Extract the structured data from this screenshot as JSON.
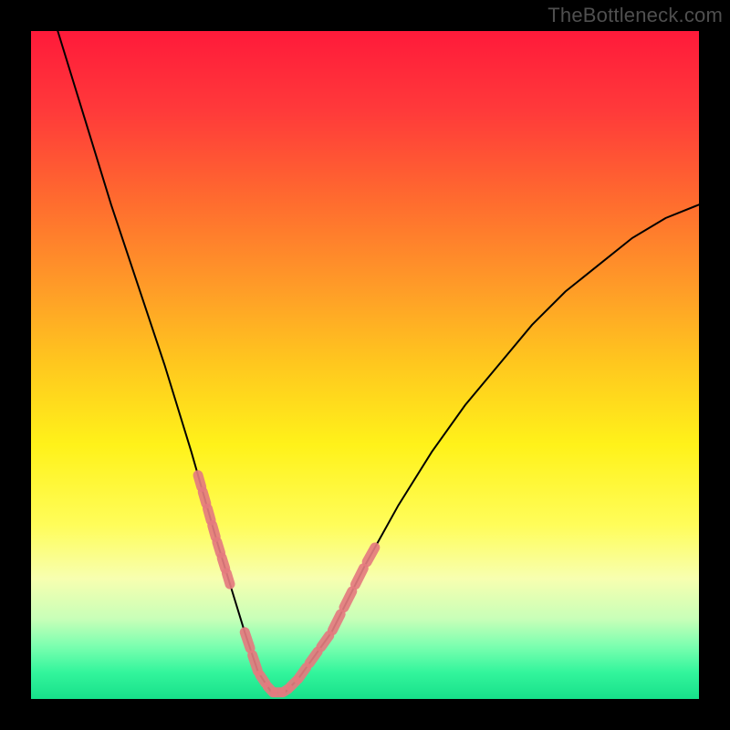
{
  "watermark_text": "TheBottleneck.com",
  "chart_data": {
    "type": "line",
    "title": "",
    "xlabel": "",
    "ylabel": "",
    "x": [
      0.04,
      0.08,
      0.12,
      0.16,
      0.2,
      0.24,
      0.28,
      0.32,
      0.34,
      0.36,
      0.38,
      0.4,
      0.45,
      0.5,
      0.55,
      0.6,
      0.65,
      0.7,
      0.75,
      0.8,
      0.85,
      0.9,
      0.95,
      1.0
    ],
    "series": [
      {
        "name": "bottleneck_curve",
        "values": [
          1.0,
          0.87,
          0.74,
          0.62,
          0.5,
          0.37,
          0.23,
          0.1,
          0.04,
          0.01,
          0.01,
          0.03,
          0.1,
          0.2,
          0.29,
          0.37,
          0.44,
          0.5,
          0.56,
          0.61,
          0.65,
          0.69,
          0.72,
          0.74
        ],
        "color": "#000000"
      }
    ],
    "annotations_x_ranges": [
      {
        "name": "left_highlight",
        "start": 0.25,
        "end": 0.3
      },
      {
        "name": "valley_highlight",
        "start": 0.32,
        "end": 0.4
      },
      {
        "name": "right_highlight",
        "start": 0.4,
        "end": 0.52
      }
    ],
    "xlim": [
      0,
      1
    ],
    "ylim": [
      0,
      1
    ],
    "legend": false,
    "grid": false
  }
}
